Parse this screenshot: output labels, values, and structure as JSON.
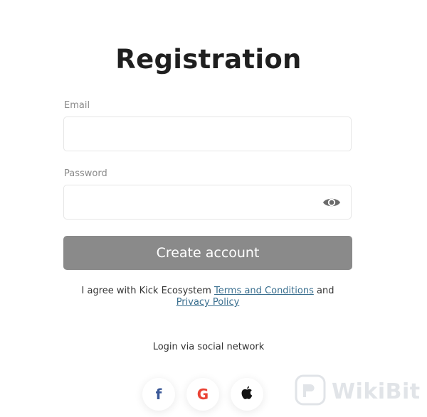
{
  "page": {
    "title": "Registration"
  },
  "form": {
    "email_label": "Email",
    "email_value": "",
    "password_label": "Password",
    "password_value": "",
    "submit_label": "Create account"
  },
  "agreement": {
    "prefix": "I agree with Kick Ecosystem ",
    "terms_link": "Terms and Conditions",
    "and_text": " and ",
    "privacy_link": "Privacy Policy"
  },
  "social": {
    "label": "Login via social network",
    "providers": [
      {
        "name": "facebook",
        "icon": "facebook-icon",
        "glyph": "f",
        "color": "#3b5998"
      },
      {
        "name": "google",
        "icon": "google-icon",
        "glyph": "G",
        "color": "#ea4335"
      },
      {
        "name": "apple",
        "icon": "apple-icon",
        "color": "#111111"
      }
    ]
  },
  "watermark": {
    "text": "WikiBit"
  },
  "colors": {
    "button_bg": "#8a8a8a",
    "link": "#3a6f8f",
    "field_border": "#e6e6e6"
  }
}
